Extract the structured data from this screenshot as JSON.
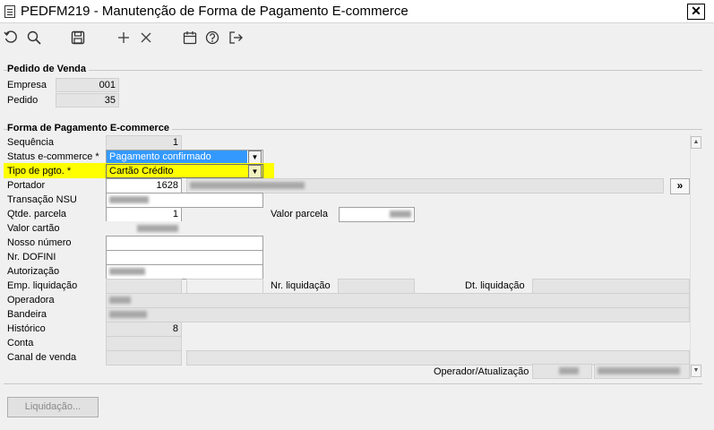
{
  "window": {
    "title": "PEDFM219 - Manutenção de Forma de Pagamento E-commerce",
    "close": "✕"
  },
  "toolbar": [
    {
      "icon": "undo-icon"
    },
    {
      "icon": "search-icon"
    },
    {
      "icon": "save-icon"
    },
    {
      "icon": "add-icon"
    },
    {
      "icon": "delete-icon"
    },
    {
      "icon": "calendar-icon"
    },
    {
      "icon": "help-icon"
    },
    {
      "icon": "exit-icon"
    }
  ],
  "pedido": {
    "group_title": "Pedido de Venda",
    "empresa_label": "Empresa",
    "empresa_value": "001",
    "pedido_label": "Pedido",
    "pedido_value": "35"
  },
  "forma": {
    "group_title": "Forma de Pagamento E-commerce",
    "sequencia_label": "Sequência",
    "sequencia_value": "1",
    "status_label": "Status e-commerce *",
    "status_value": "Pagamento confirmado",
    "tipo_label": "Tipo de pgto. *",
    "tipo_value": "Cartão Crédito",
    "portador_label": "Portador",
    "portador_value": "1628",
    "portador_lookup": "»",
    "transacao_label": "Transação NSU",
    "qtde_label": "Qtde. parcela",
    "qtde_value": "1",
    "valor_parcela_label": "Valor parcela",
    "valor_cartao_label": "Valor cartão",
    "nosso_numero_label": "Nosso número",
    "nr_dofini_label": "Nr. DOFINI",
    "autorizacao_label": "Autorização",
    "emp_liquidacao_label": "Emp. liquidação",
    "nr_liquidacao_label": "Nr. liquidação",
    "dt_liquidacao_label": "Dt. liquidação",
    "operadora_label": "Operadora",
    "bandeira_label": "Bandeira",
    "historico_label": "Histórico",
    "historico_value": "8",
    "conta_label": "Conta",
    "canal_label": "Canal de venda",
    "operador_label": "Operador/Atualização"
  },
  "buttons": {
    "liquidacao": "Liquidação..."
  },
  "colors": {
    "selected_blue": "#3399ff",
    "highlight_yellow": "#ffff00"
  }
}
